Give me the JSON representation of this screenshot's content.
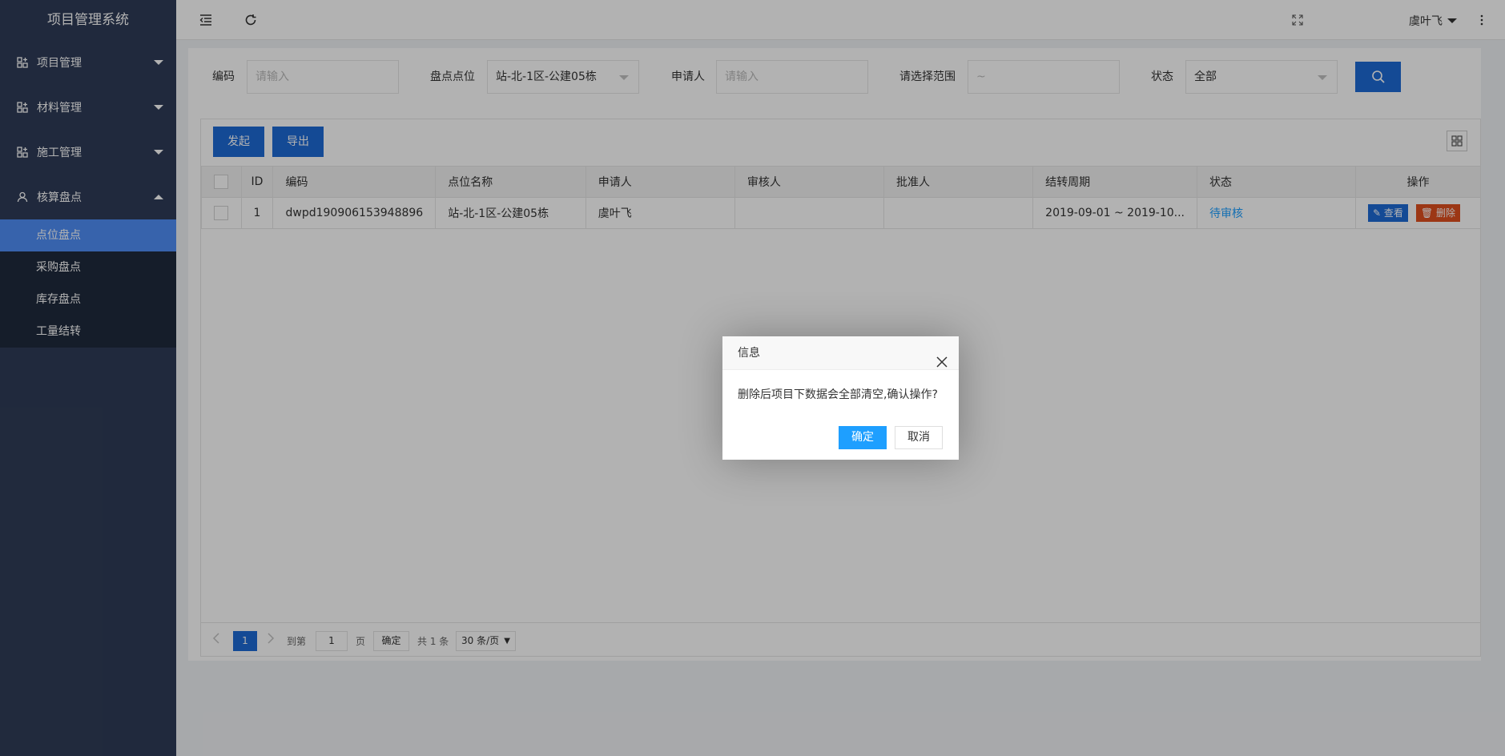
{
  "app": {
    "title": "项目管理系统"
  },
  "sidebar": {
    "groups": [
      {
        "label": "项目管理",
        "icon": "grid-plus-icon",
        "expanded": false
      },
      {
        "label": "材料管理",
        "icon": "grid-plus-icon",
        "expanded": false
      },
      {
        "label": "施工管理",
        "icon": "grid-plus-icon",
        "expanded": false
      },
      {
        "label": "核算盘点",
        "icon": "user-icon",
        "expanded": true
      }
    ],
    "subitems": [
      "点位盘点",
      "采购盘点",
      "库存盘点",
      "工量结转"
    ],
    "active_subitem": "点位盘点"
  },
  "header": {
    "user": "虞叶飞",
    "icons": [
      "menu-fold-icon",
      "refresh-icon",
      "fullscreen-icon",
      "more-icon"
    ]
  },
  "filters": {
    "code_label": "编码",
    "code_placeholder": "请输入",
    "point_label": "盘点点位",
    "point_value": "站-北-1区-公建05栋",
    "applicant_label": "申请人",
    "applicant_placeholder": "请输入",
    "range_label": "请选择范围",
    "range_placeholder": "~",
    "status_label": "状态",
    "status_value": "全部"
  },
  "toolbar": {
    "create_label": "发起",
    "export_label": "导出"
  },
  "table": {
    "headers": [
      "ID",
      "编码",
      "点位名称",
      "申请人",
      "审核人",
      "批准人",
      "结转周期",
      "状态",
      "操作"
    ],
    "rows": [
      {
        "id": "1",
        "code": "dwpd190906153948896",
        "point_name": "站-北-1区-公建05栋",
        "applicant": "虞叶飞",
        "reviewer": "",
        "approver": "",
        "period": "2019-09-01 ~ 2019-10...",
        "status": "待审核",
        "view_label": "查看",
        "delete_label": "删除"
      }
    ]
  },
  "pager": {
    "current_page": "1",
    "goto_label": "到第",
    "goto_value": "1",
    "page_unit": "页",
    "confirm_label": "确定",
    "total": "共 1 条",
    "page_size": "30 条/页"
  },
  "dialog": {
    "title": "信息",
    "message": "删除后项目下数据会全部清空,确认操作?",
    "ok_label": "确定",
    "cancel_label": "取消"
  },
  "colors": {
    "sidebar": "#2f3c58",
    "active": "#4f8ef7",
    "primary": "#1e6bd6",
    "link": "#1e9fff",
    "danger": "#e04f1f"
  }
}
